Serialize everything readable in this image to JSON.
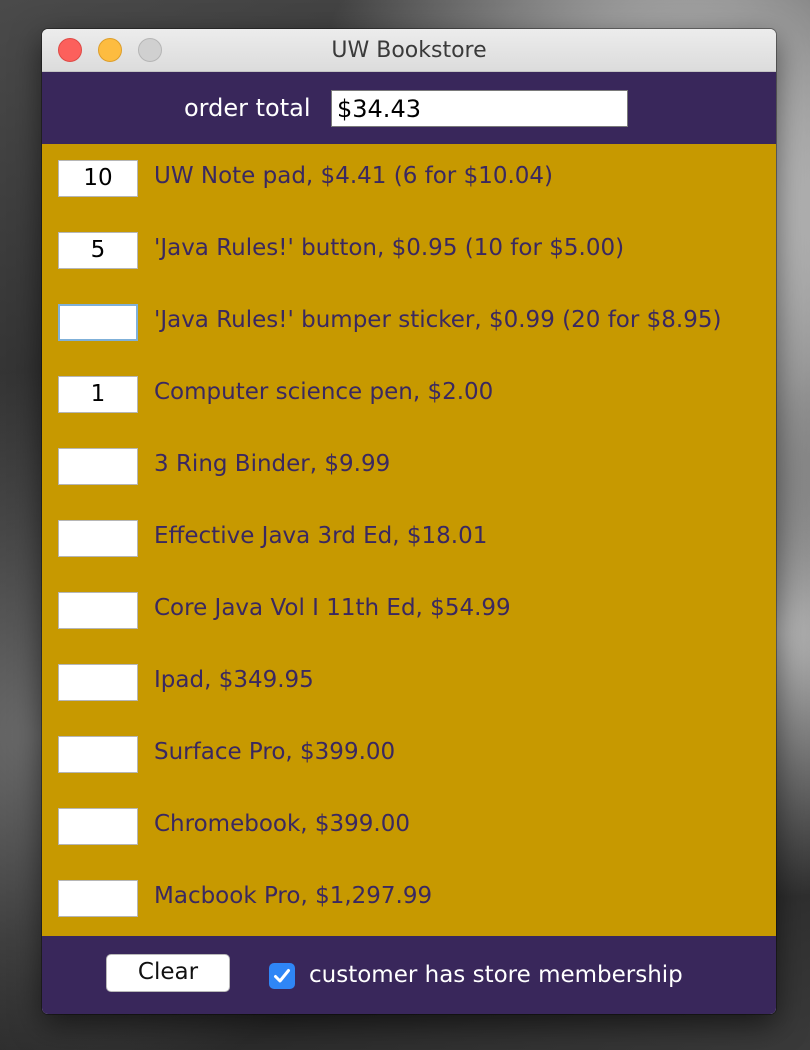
{
  "window": {
    "title": "UW Bookstore"
  },
  "order": {
    "total_label": "order total",
    "total_value": "$34.43"
  },
  "items": [
    {
      "quantity": "10",
      "label": "UW Note pad, $4.41 (6 for $10.04)"
    },
    {
      "quantity": "5",
      "label": "'Java Rules!' button, $0.95 (10 for $5.00)"
    },
    {
      "quantity": "",
      "label": "'Java Rules!' bumper sticker, $0.99 (20 for $8.95)"
    },
    {
      "quantity": "1",
      "label": "Computer science pen, $2.00"
    },
    {
      "quantity": "",
      "label": "3 Ring Binder, $9.99"
    },
    {
      "quantity": "",
      "label": "Effective Java 3rd Ed, $18.01"
    },
    {
      "quantity": "",
      "label": "Core Java Vol I 11th Ed, $54.99"
    },
    {
      "quantity": "",
      "label": "Ipad, $349.95"
    },
    {
      "quantity": "",
      "label": "Surface Pro, $399.00"
    },
    {
      "quantity": "",
      "label": "Chromebook, $399.00"
    },
    {
      "quantity": "",
      "label": "Macbook Pro, $1,297.99"
    }
  ],
  "footer": {
    "clear_label": "Clear",
    "membership_label": "customer has store membership",
    "membership_checked": true
  },
  "colors": {
    "purple": "#39275b",
    "gold": "#c79900",
    "item_text": "#3a2860",
    "checkbox_blue": "#2f86f6"
  },
  "icons": {
    "checkbox": "checkmark-icon"
  }
}
